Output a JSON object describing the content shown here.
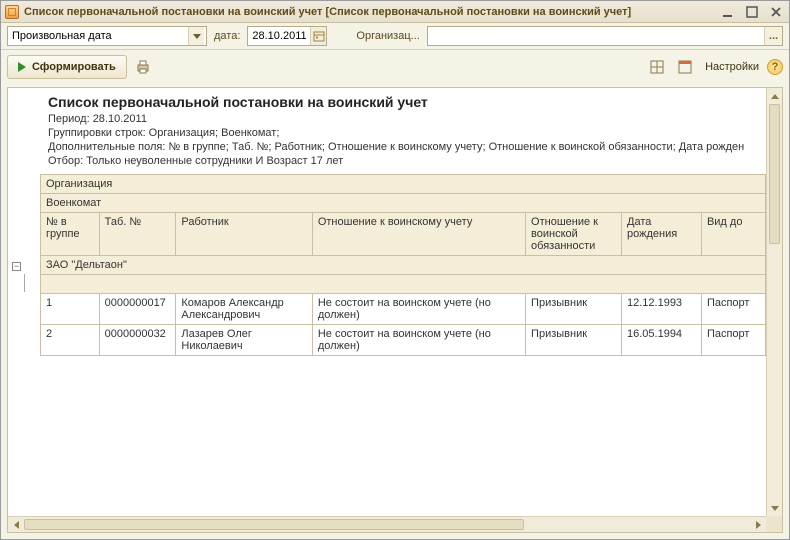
{
  "window": {
    "title": "Список первоначальной постановки на воинский учет [Список первоначальной постановки на воинский учет]"
  },
  "toolbar1": {
    "period_mode": "Произвольная дата",
    "date_label": "дата:",
    "date_value": "28.10.2011",
    "org_label": "Организац...",
    "org_value": "",
    "ellipsis": "..."
  },
  "toolbar2": {
    "generate_label": "Сформировать",
    "settings_label": "Настройки",
    "help_label": "?"
  },
  "report": {
    "title": "Список первоначальной постановки на воинский учет",
    "meta": {
      "period": "Период: 28.10.2011",
      "groupings": "Группировки строк: Организация; Военкомат;",
      "extra_fields": "Дополнительные поля: № в группе; Таб. №; Работник; Отношение к воинскому учету; Отношение к воинской обязанности; Дата рожден",
      "filter": "Отбор: Только неуволенные сотрудники И Возраст 17 лет"
    },
    "section_labels": {
      "org": "Организация",
      "commissariat": "Военкомат"
    },
    "columns": {
      "num": "№ в группе",
      "tab": "Таб. №",
      "worker": "Работник",
      "mil_account": "Отношение к воинскому учету",
      "mil_duty": "Отношение к воинской обязанности",
      "birth": "Дата рождения",
      "doc": "Вид до"
    },
    "group": {
      "name": "ЗАО \"Дельтаон\""
    },
    "rows": [
      {
        "num": "1",
        "tab": "0000000017",
        "worker": "Комаров Александр Александрович",
        "mil_account": "Не состоит на воинском учете (но должен)",
        "mil_duty": "Призывник",
        "birth": "12.12.1993",
        "doc": "Паспорт"
      },
      {
        "num": "2",
        "tab": "0000000032",
        "worker": "Лазарев Олег Николаевич",
        "mil_account": "Не состоит на воинском учете (но должен)",
        "mil_duty": "Призывник",
        "birth": "16.05.1994",
        "doc": "Паспорт"
      }
    ]
  }
}
